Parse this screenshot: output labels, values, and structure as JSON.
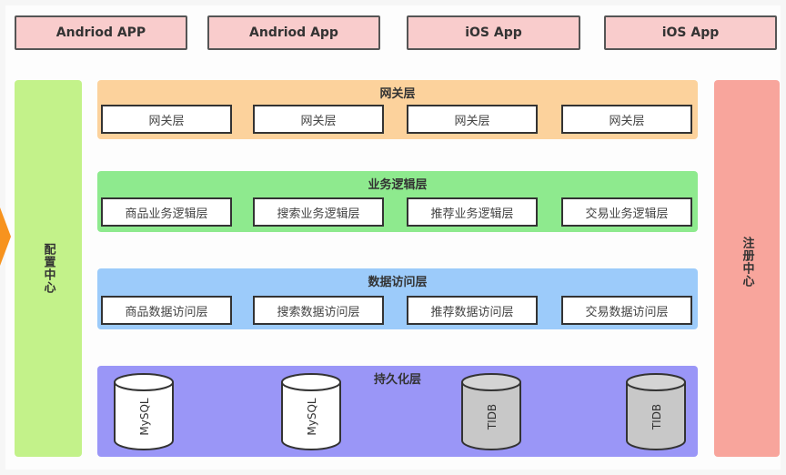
{
  "apps": [
    "Andriod APP",
    "Andriod App",
    "iOS App",
    "iOS App"
  ],
  "config_center": "配置中心",
  "registry_center": "注册中心",
  "gateway": {
    "title": "网关层",
    "items": [
      "网关层",
      "网关层",
      "网关层",
      "网关层"
    ]
  },
  "business": {
    "title": "业务逻辑层",
    "items": [
      "商品业务逻辑层",
      "搜索业务逻辑层",
      "推荐业务逻辑层",
      "交易业务逻辑层"
    ]
  },
  "data_access": {
    "title": "数据访问层",
    "items": [
      "商品数据访问层",
      "搜索数据访问层",
      "推荐数据访问层",
      "交易数据访问层"
    ]
  },
  "persistence": {
    "title": "持久化层",
    "databases": [
      "MySQL",
      "MySQL",
      "TIDB",
      "TIDB"
    ]
  },
  "colors": {
    "app": "#f9cccc",
    "config": "#c3f28a",
    "registry": "#f8a59c",
    "gateway": "#fcd29c",
    "business": "#8eea8e",
    "data_access": "#9ccbfa",
    "persistence": "#9a96f7"
  }
}
